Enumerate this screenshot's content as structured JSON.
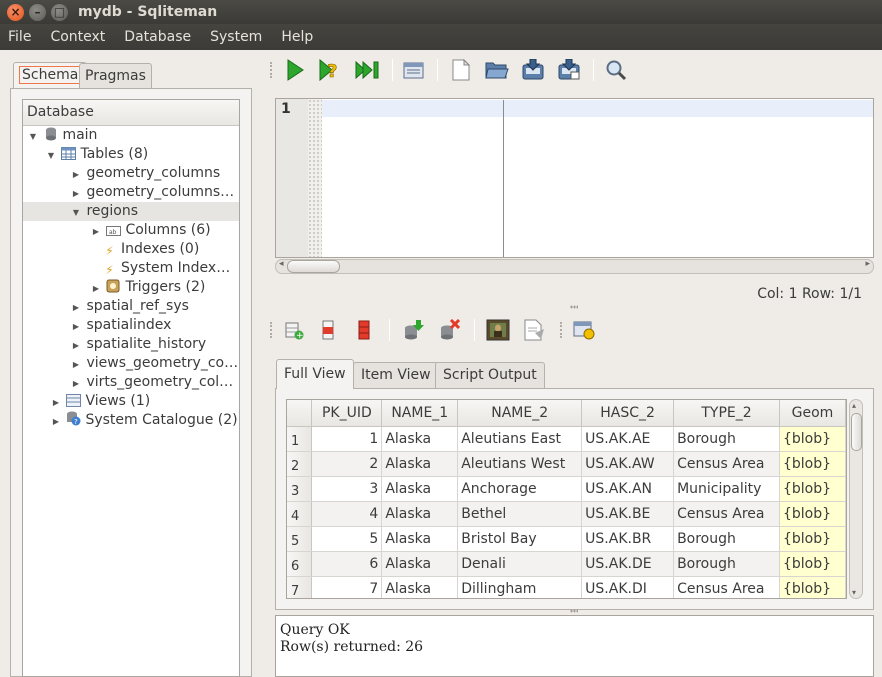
{
  "window": {
    "title": "mydb - Sqliteman"
  },
  "menu": [
    "File",
    "Context",
    "Database",
    "System",
    "Help"
  ],
  "left_tabs": {
    "schema": "Schema",
    "pragmas": "Pragmas"
  },
  "tree": {
    "header": "Database",
    "nodes": {
      "main": "main",
      "tables": "Tables (8)",
      "t1": "geometry_columns",
      "t2": "geometry_columns…",
      "t3": "regions",
      "columns": "Columns (6)",
      "indexes": "Indexes (0)",
      "sysindexes": "System Index…",
      "triggers": "Triggers (2)",
      "t4": "spatial_ref_sys",
      "t5": "spatialindex",
      "t6": "spatialite_history",
      "t7": "views_geometry_co…",
      "t8": "virts_geometry_col…",
      "views": "Views (1)",
      "catalogue": "System Catalogue (2)"
    }
  },
  "editor": {
    "line_number": "1"
  },
  "status": {
    "position": "Col: 1 Row: 1/1"
  },
  "result_tabs": {
    "full": "Full View",
    "item": "Item View",
    "script": "Script Output"
  },
  "grid": {
    "columns": [
      "PK_UID",
      "NAME_1",
      "NAME_2",
      "HASC_2",
      "TYPE_2",
      "Geom"
    ],
    "rows": [
      {
        "n": "1",
        "pk": "1",
        "name1": "Alaska",
        "name2": "Aleutians East",
        "hasc": "US.AK.AE",
        "type": "Borough",
        "geom": "{blob}"
      },
      {
        "n": "2",
        "pk": "2",
        "name1": "Alaska",
        "name2": "Aleutians West",
        "hasc": "US.AK.AW",
        "type": "Census Area",
        "geom": "{blob}"
      },
      {
        "n": "3",
        "pk": "3",
        "name1": "Alaska",
        "name2": "Anchorage",
        "hasc": "US.AK.AN",
        "type": "Municipality",
        "geom": "{blob}"
      },
      {
        "n": "4",
        "pk": "4",
        "name1": "Alaska",
        "name2": "Bethel",
        "hasc": "US.AK.BE",
        "type": "Census Area",
        "geom": "{blob}"
      },
      {
        "n": "5",
        "pk": "5",
        "name1": "Alaska",
        "name2": "Bristol Bay",
        "hasc": "US.AK.BR",
        "type": "Borough",
        "geom": "{blob}"
      },
      {
        "n": "6",
        "pk": "6",
        "name1": "Alaska",
        "name2": "Denali",
        "hasc": "US.AK.DE",
        "type": "Borough",
        "geom": "{blob}"
      },
      {
        "n": "7",
        "pk": "7",
        "name1": "Alaska",
        "name2": "Dillingham",
        "hasc": "US.AK.DI",
        "type": "Census Area",
        "geom": "{blob}"
      }
    ]
  },
  "messages": {
    "line1": "Query OK",
    "line2": "Row(s) returned: 26"
  },
  "colors": {
    "accent": "#f07746",
    "blob_bg": "#ffffd0",
    "titlebar": "#3c3b37"
  },
  "icons": {
    "toolbar": [
      "run-icon",
      "explain-icon",
      "run-script-icon",
      "history-icon",
      "new-file-icon",
      "open-file-icon",
      "save-file-icon",
      "save-as-icon",
      "search-icon"
    ],
    "results_toolbar": [
      "add-row-icon",
      "remove-row-icon",
      "truncate-icon",
      "commit-icon",
      "rollback-icon",
      "blob-preview-icon",
      "export-icon",
      "action-icon"
    ]
  }
}
